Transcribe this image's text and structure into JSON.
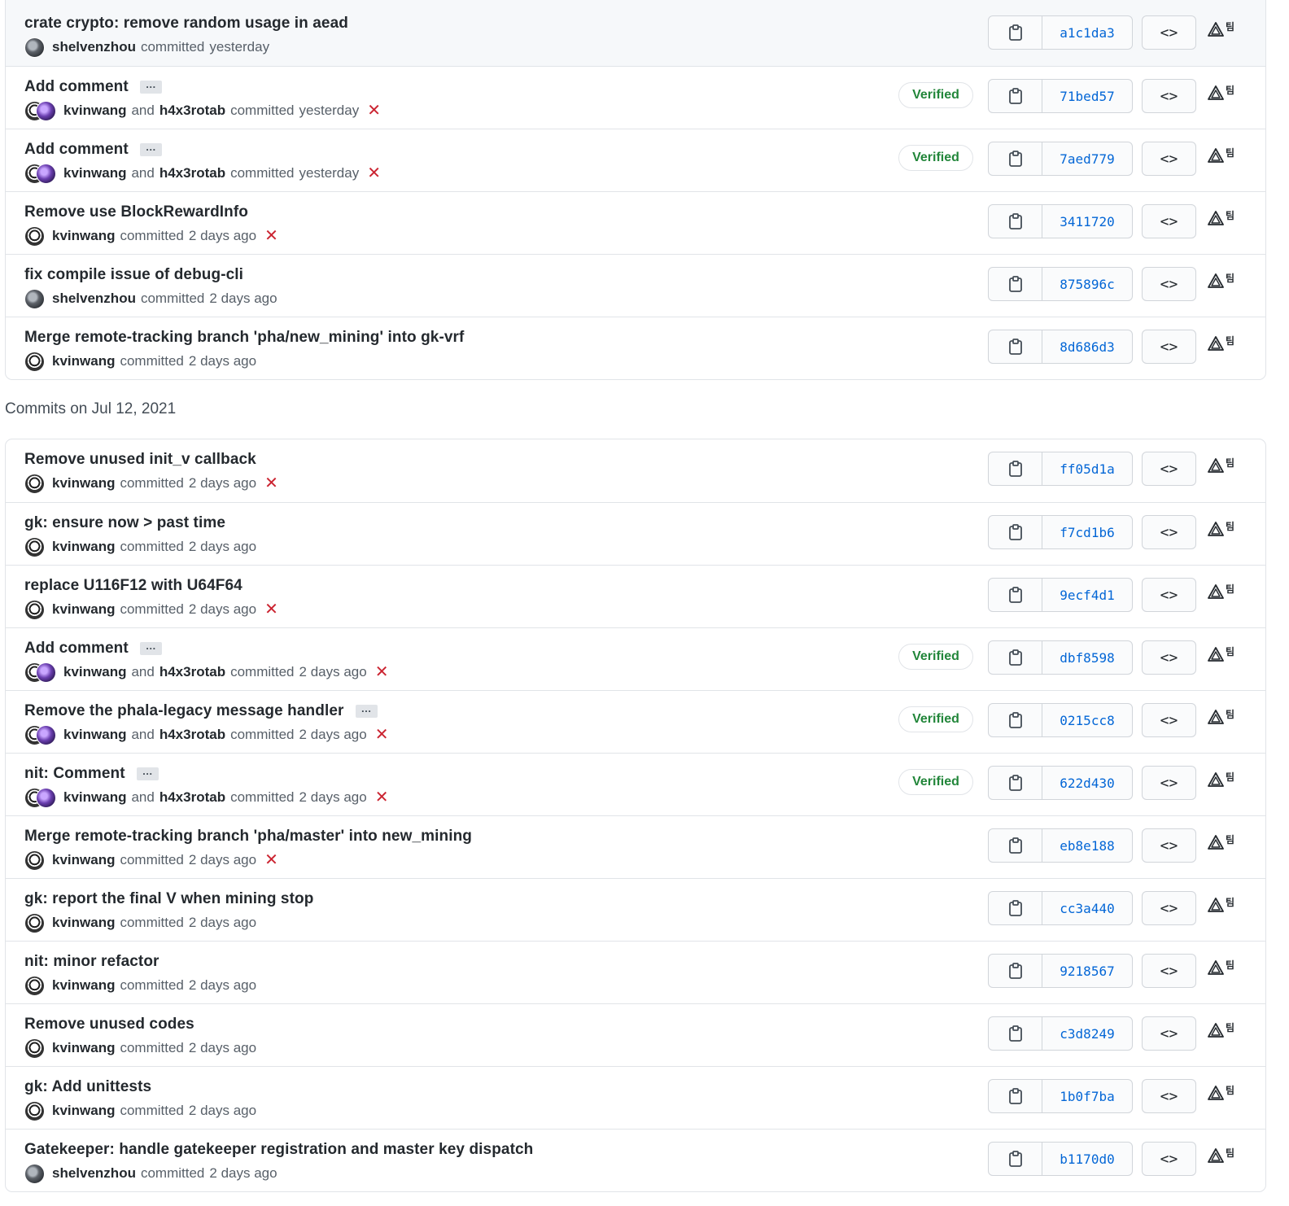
{
  "group_top": [
    {
      "message": "crate crypto: remove random usage in aead",
      "authors": [
        "shelvenzhou"
      ],
      "avatars": [
        "s"
      ],
      "time": "yesterday",
      "verified": false,
      "status": "none",
      "ellipsis": false,
      "sha": "a1c1da3"
    },
    {
      "message": "Add comment",
      "authors": [
        "kvinwang",
        "h4x3rotab"
      ],
      "avatars": [
        "k",
        "h"
      ],
      "time": "yesterday",
      "verified": true,
      "status": "x",
      "ellipsis": true,
      "sha": "71bed57"
    },
    {
      "message": "Add comment",
      "authors": [
        "kvinwang",
        "h4x3rotab"
      ],
      "avatars": [
        "k",
        "h"
      ],
      "time": "yesterday",
      "verified": true,
      "status": "x",
      "ellipsis": true,
      "sha": "7aed779"
    },
    {
      "message": "Remove use BlockRewardInfo",
      "authors": [
        "kvinwang"
      ],
      "avatars": [
        "k"
      ],
      "time": "2 days ago",
      "verified": false,
      "status": "x",
      "ellipsis": false,
      "sha": "3411720"
    },
    {
      "message": "fix compile issue of debug-cli",
      "authors": [
        "shelvenzhou"
      ],
      "avatars": [
        "s"
      ],
      "time": "2 days ago",
      "verified": false,
      "status": "none",
      "ellipsis": false,
      "sha": "875896c"
    },
    {
      "message": "Merge remote-tracking branch 'pha/new_mining' into gk-vrf",
      "authors": [
        "kvinwang"
      ],
      "avatars": [
        "k"
      ],
      "time": "2 days ago",
      "verified": false,
      "status": "none",
      "ellipsis": false,
      "sha": "8d686d3"
    }
  ],
  "date_heading": "Commits on Jul 12, 2021",
  "group_second": [
    {
      "message": "Remove unused init_v callback",
      "authors": [
        "kvinwang"
      ],
      "avatars": [
        "k"
      ],
      "time": "2 days ago",
      "verified": false,
      "status": "x",
      "ellipsis": false,
      "sha": "ff05d1a"
    },
    {
      "message": "gk: ensure now > past time",
      "authors": [
        "kvinwang"
      ],
      "avatars": [
        "k"
      ],
      "time": "2 days ago",
      "verified": false,
      "status": "none",
      "ellipsis": false,
      "sha": "f7cd1b6"
    },
    {
      "message": "replace U116F12 with U64F64",
      "authors": [
        "kvinwang"
      ],
      "avatars": [
        "k"
      ],
      "time": "2 days ago",
      "verified": false,
      "status": "x",
      "ellipsis": false,
      "sha": "9ecf4d1"
    },
    {
      "message": "Add comment",
      "authors": [
        "kvinwang",
        "h4x3rotab"
      ],
      "avatars": [
        "k",
        "h"
      ],
      "time": "2 days ago",
      "verified": true,
      "status": "x",
      "ellipsis": true,
      "sha": "dbf8598"
    },
    {
      "message": "Remove the phala-legacy message handler",
      "authors": [
        "kvinwang",
        "h4x3rotab"
      ],
      "avatars": [
        "k",
        "h"
      ],
      "time": "2 days ago",
      "verified": true,
      "status": "x",
      "ellipsis": true,
      "sha": "0215cc8"
    },
    {
      "message": "nit: Comment",
      "authors": [
        "kvinwang",
        "h4x3rotab"
      ],
      "avatars": [
        "k",
        "h"
      ],
      "time": "2 days ago",
      "verified": true,
      "status": "x",
      "ellipsis": true,
      "sha": "622d430"
    },
    {
      "message": "Merge remote-tracking branch 'pha/master' into new_mining",
      "authors": [
        "kvinwang"
      ],
      "avatars": [
        "k"
      ],
      "time": "2 days ago",
      "verified": false,
      "status": "x",
      "ellipsis": false,
      "sha": "eb8e188"
    },
    {
      "message": "gk: report the final V when mining stop",
      "authors": [
        "kvinwang"
      ],
      "avatars": [
        "k"
      ],
      "time": "2 days ago",
      "verified": false,
      "status": "none",
      "ellipsis": false,
      "sha": "cc3a440"
    },
    {
      "message": "nit: minor refactor",
      "authors": [
        "kvinwang"
      ],
      "avatars": [
        "k"
      ],
      "time": "2 days ago",
      "verified": false,
      "status": "none",
      "ellipsis": false,
      "sha": "9218567"
    },
    {
      "message": "Remove unused codes",
      "authors": [
        "kvinwang"
      ],
      "avatars": [
        "k"
      ],
      "time": "2 days ago",
      "verified": false,
      "status": "none",
      "ellipsis": false,
      "sha": "c3d8249"
    },
    {
      "message": "gk: Add unittests",
      "authors": [
        "kvinwang"
      ],
      "avatars": [
        "k"
      ],
      "time": "2 days ago",
      "verified": false,
      "status": "none",
      "ellipsis": false,
      "sha": "1b0f7ba"
    },
    {
      "message": "Gatekeeper: handle gatekeeper registration and master key dispatch",
      "authors": [
        "shelvenzhou"
      ],
      "avatars": [
        "s"
      ],
      "time": "2 days ago",
      "verified": false,
      "status": "none",
      "ellipsis": false,
      "sha": "b1170d0"
    }
  ],
  "labels": {
    "verified": "Verified",
    "and": "and",
    "committed": "committed",
    "ellipsis": "…",
    "browse": "<>",
    "status_fail": "✕",
    "ext_glyph": "팀"
  },
  "icons": {
    "copy": "clipboard-icon",
    "browse": "code-icon",
    "ext": "triangle-icon",
    "fail": "x-icon"
  },
  "colors": {
    "link": "#0366d6",
    "verified": "#22863a",
    "fail": "#cb2431",
    "border": "#e1e4e8"
  }
}
